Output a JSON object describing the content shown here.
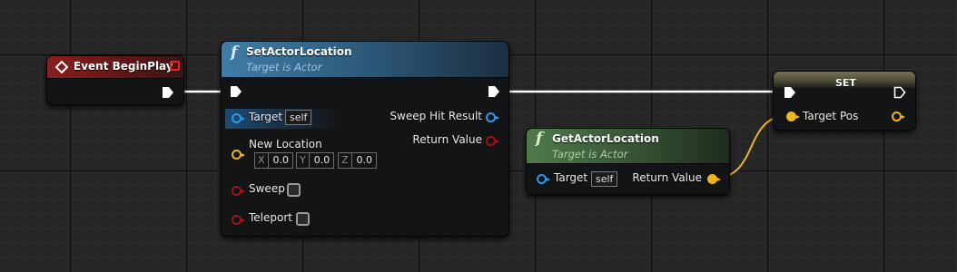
{
  "colors": {
    "graph_background": "#262626",
    "exec_wire": "#ffffff",
    "vector_wire": "#f0b51b",
    "object_pin": "#2c9be8",
    "struct_pin": "#a3121a",
    "bool_pin": "#a3121a",
    "event_header": "#8c1e1e",
    "function_header": "#3f7ca6",
    "pure_function_header": "#4f7a4b",
    "set_header": "#6d6a4a"
  },
  "event_node": {
    "title": "Event BeginPlay",
    "icon": "event-diamond-icon",
    "delegate_icon": "delegate-square-icon"
  },
  "set_actor_location": {
    "icon": "function-icon",
    "title": "SetActorLocation",
    "subtitle": "Target is Actor",
    "inputs": {
      "target_label": "Target",
      "target_default": "self",
      "new_location_label": "New Location",
      "x_axis": "X",
      "x_value": "0.0",
      "y_axis": "Y",
      "y_value": "0.0",
      "z_axis": "Z",
      "z_value": "0.0",
      "sweep_label": "Sweep",
      "teleport_label": "Teleport"
    },
    "outputs": {
      "sweep_hit_result_label": "Sweep Hit Result",
      "return_value_label": "Return Value"
    }
  },
  "get_actor_location": {
    "icon": "function-icon",
    "title": "GetActorLocation",
    "subtitle": "Target is Actor",
    "target_label": "Target",
    "target_default": "self",
    "return_value_label": "Return Value"
  },
  "set_node": {
    "title": "SET",
    "input_label": "Target Pos"
  }
}
